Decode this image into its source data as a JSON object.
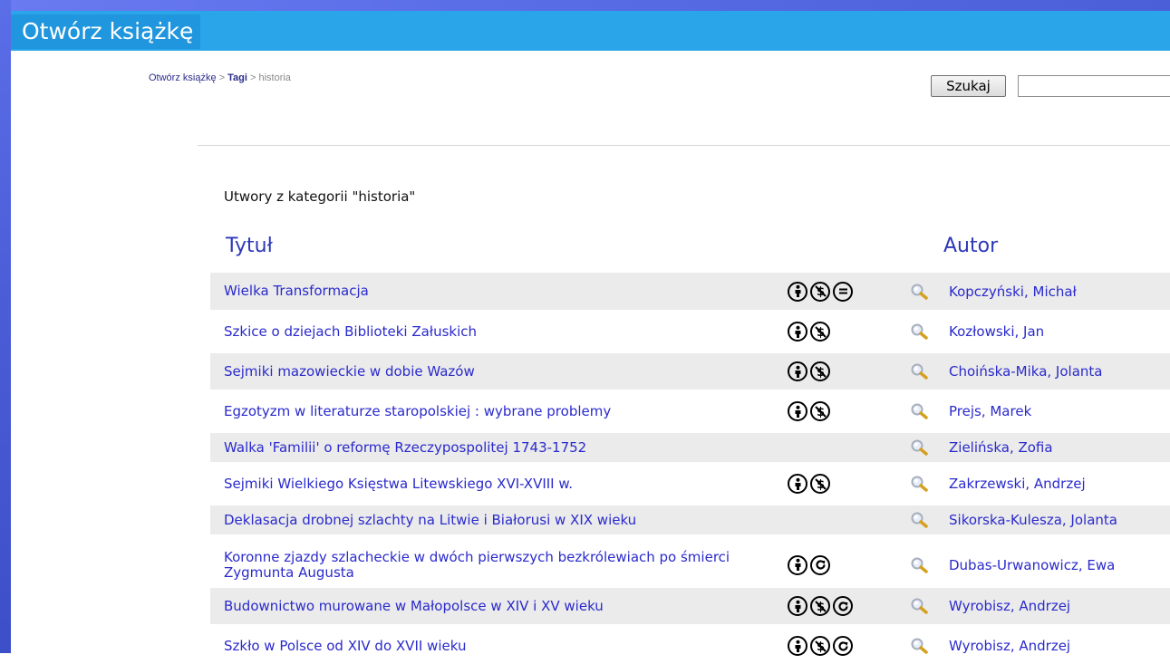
{
  "app": {
    "brand": "Otwórz książkę"
  },
  "breadcrumb": {
    "home": "Otwórz książkę",
    "sep1": " > ",
    "tags": "Tagi",
    "sep2": " > ",
    "current": "historia"
  },
  "search": {
    "button_label": "Szukaj",
    "value": ""
  },
  "category_heading": "Utwory z kategorii \"historia\"",
  "columns": {
    "title": "Tytuł",
    "author": "Autor"
  },
  "rows": [
    {
      "title": "Wielka Transformacja",
      "licenses": [
        "by",
        "nc",
        "nd"
      ],
      "author": "Kopczyński, Michał"
    },
    {
      "title": "Szkice o dziejach Biblioteki Załuskich",
      "licenses": [
        "by",
        "nc"
      ],
      "author": "Kozłowski, Jan"
    },
    {
      "title": "Sejmiki mazowieckie w dobie Wazów",
      "licenses": [
        "by",
        "nc"
      ],
      "author": "Choińska-Mika, Jolanta"
    },
    {
      "title": "Egzotyzm w literaturze staropolskiej : wybrane problemy",
      "licenses": [
        "by",
        "nc"
      ],
      "author": "Prejs, Marek"
    },
    {
      "title": "Walka 'Familii' o reformę Rzeczypospolitej 1743-1752",
      "licenses": [],
      "author": "Zielińska, Zofia"
    },
    {
      "title": "Sejmiki Wielkiego Księstwa Litewskiego XVI-XVIII w.",
      "licenses": [
        "by",
        "nc"
      ],
      "author": "Zakrzewski, Andrzej"
    },
    {
      "title": "Deklasacja drobnej szlachty na Litwie i Białorusi w XIX wieku",
      "licenses": [],
      "author": "Sikorska-Kulesza, Jolanta"
    },
    {
      "title": "Koronne zjazdy szlacheckie w dwóch pierwszych bezkrólewiach po śmierci Zygmunta Augusta",
      "licenses": [
        "by",
        "sa"
      ],
      "author": "Dubas-Urwanowicz, Ewa"
    },
    {
      "title": "Budownictwo murowane w Małopolsce w XIV i XV wieku",
      "licenses": [
        "by",
        "nc",
        "sa"
      ],
      "author": "Wyrobisz, Andrzej"
    },
    {
      "title": "Szkło w Polsce od XIV do XVII wieku",
      "licenses": [
        "by",
        "nc",
        "sa"
      ],
      "author": "Wyrobisz, Andrzej"
    }
  ],
  "icons": {
    "by": "cc-by-icon",
    "nc": "cc-nc-icon",
    "nd": "cc-nd-icon",
    "sa": "cc-sa-icon",
    "search": "magnifier-icon"
  },
  "colors": {
    "header": "#2aa5ea",
    "brand_bg": "#1f96dd",
    "link": "#2a2acc",
    "column_header": "#2d39b8",
    "row_alt": "#ebebeb"
  }
}
